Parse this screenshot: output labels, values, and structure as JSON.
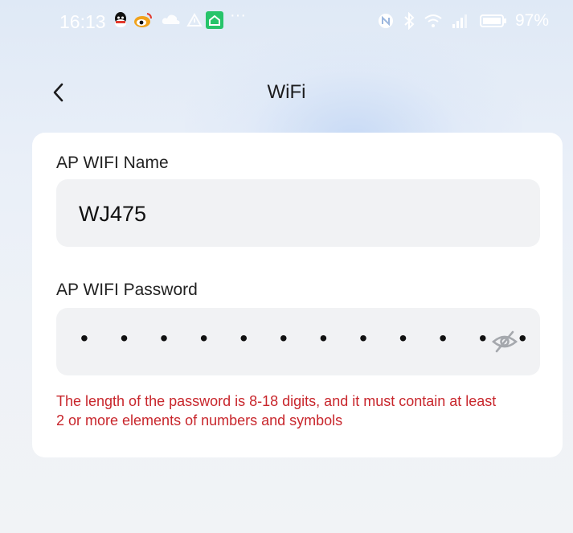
{
  "status_bar": {
    "time": "16:13",
    "battery_percent": "97%",
    "icons_left": [
      "qq-icon",
      "weibo-icon",
      "cloud-icon",
      "warning-icon",
      "home-app-icon",
      "more-dots-icon"
    ],
    "icons_right": [
      "nfc-icon",
      "bluetooth-icon",
      "wifi-icon",
      "signal-icon",
      "battery-icon"
    ]
  },
  "header": {
    "title": "WiFi",
    "back_icon": "chevron-left-icon"
  },
  "form": {
    "name_label": "AP WIFI Name",
    "name_value": "WJ475",
    "password_label": "AP WIFI Password",
    "password_value": "• • • • • • • • • • • •",
    "visibility_icon": "eye-off-icon",
    "error_message": "The length of the password is 8-18 digits, and it must contain at least 2 or more elements of numbers and symbols"
  },
  "colors": {
    "error": "#c8262c",
    "card_bg": "#ffffff",
    "input_bg": "#f1f2f4",
    "title": "#1c1c1e"
  }
}
